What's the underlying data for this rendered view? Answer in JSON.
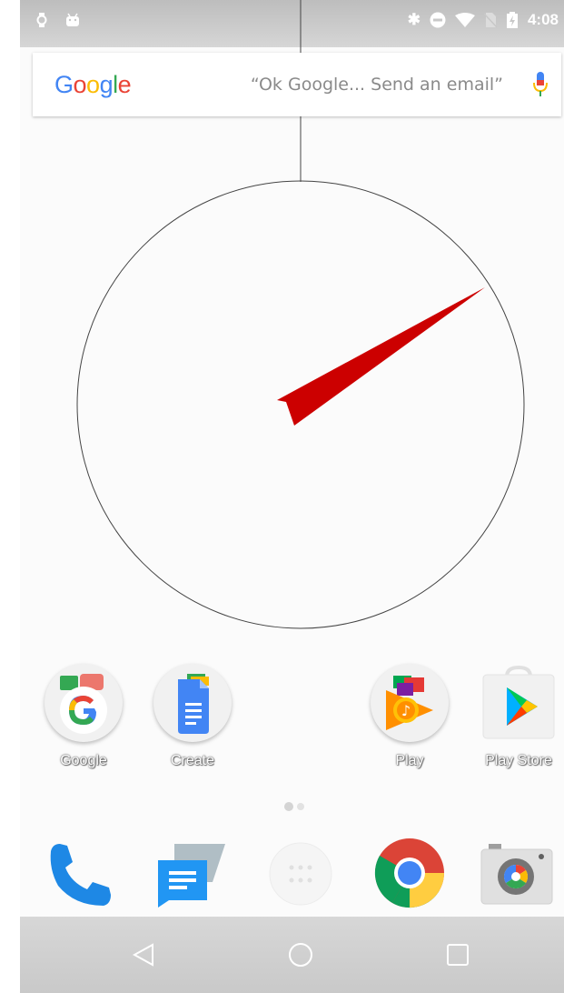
{
  "status_bar": {
    "time": "4:08",
    "left_icons": [
      "watch-icon",
      "android-icon"
    ],
    "right_icons": [
      "bluetooth-icon",
      "do-not-disturb-icon",
      "wifi-icon",
      "no-sim-icon",
      "battery-charging-icon"
    ]
  },
  "search": {
    "logo_letters": [
      "G",
      "o",
      "o",
      "g",
      "l",
      "e"
    ],
    "hint": "“Ok Google... Send an email”",
    "mic_icon": "mic-icon"
  },
  "clock_widget": {
    "hand_color": "#cc0000",
    "outline_color": "#444444"
  },
  "home_apps": [
    {
      "label": "Google",
      "icon": "google-folder-icon"
    },
    {
      "label": "Create",
      "icon": "docs-folder-icon"
    },
    {
      "label": "Play",
      "icon": "play-folder-icon"
    },
    {
      "label": "Play Store",
      "icon": "play-store-icon"
    }
  ],
  "dock_apps": [
    {
      "name": "Phone",
      "icon": "phone-icon"
    },
    {
      "name": "Messages",
      "icon": "messages-icon"
    },
    {
      "name": "App drawer",
      "icon": "app-drawer-icon"
    },
    {
      "name": "Chrome",
      "icon": "chrome-icon"
    },
    {
      "name": "Camera",
      "icon": "camera-icon"
    }
  ],
  "nav": {
    "back": "back-icon",
    "home": "home-icon",
    "recents": "recents-icon"
  },
  "colors": {
    "google_blue": "#4285F4",
    "google_red": "#EA4335",
    "google_yellow": "#FBBC05",
    "google_green": "#34A853"
  }
}
